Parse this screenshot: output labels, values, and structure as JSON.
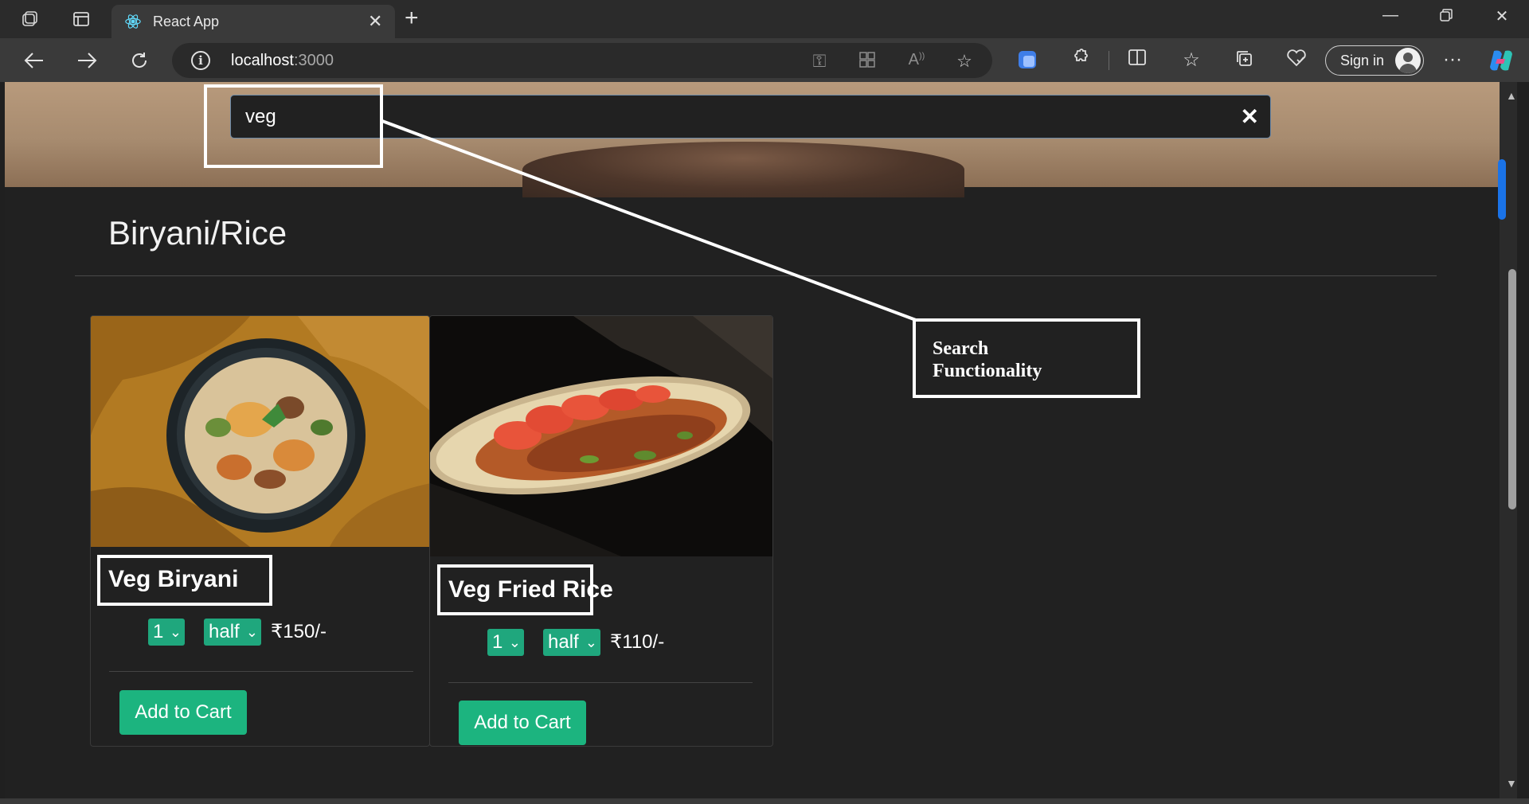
{
  "browser": {
    "tab_title": "React App",
    "url_host": "localhost",
    "url_port": ":3000",
    "sign_in_label": "Sign in"
  },
  "page": {
    "search": {
      "value": "veg"
    },
    "category_title": "Biryani/Rice",
    "items": [
      {
        "name": "Veg Biryani",
        "quantity": "1",
        "size": "half",
        "price": "₹150/-",
        "cart_label": "Add to Cart"
      },
      {
        "name": "Veg Fried Rice",
        "quantity": "1",
        "size": "half",
        "price": "₹110/-",
        "cart_label": "Add to Cart"
      }
    ],
    "accent_color": "#1cb47f"
  },
  "annotation": {
    "label_line1": "Search",
    "label_line2": "Functionality"
  }
}
